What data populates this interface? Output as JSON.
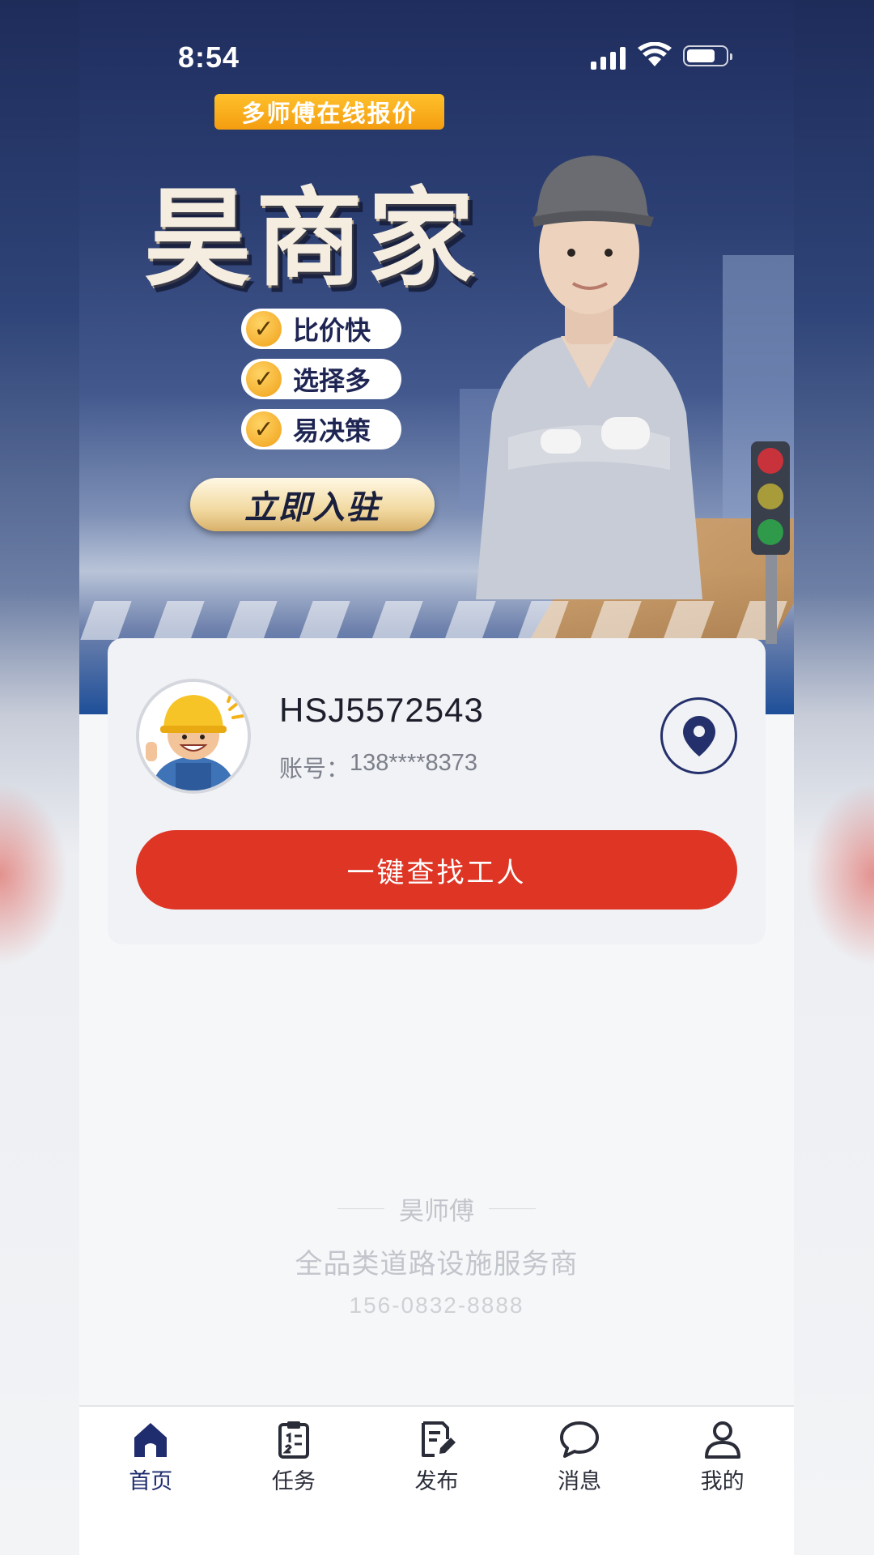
{
  "status_bar": {
    "time": "8:54"
  },
  "banner": {
    "tag": "多师傅在线报价",
    "brand": "昊商家",
    "features": [
      "比价快",
      "选择多",
      "易决策"
    ],
    "join_label": "立即入驻"
  },
  "profile": {
    "username": "HSJ5572543",
    "account_label": "账号：",
    "account_value": "138****8373",
    "find_worker_label": "一键查找工人"
  },
  "footer": {
    "name": "昊师傅",
    "slogan": "全品类道路设施服务商",
    "phone": "156-0832-8888"
  },
  "tabbar": {
    "items": [
      {
        "label": "首页",
        "icon": "home-icon",
        "active": true
      },
      {
        "label": "任务",
        "icon": "clipboard-icon",
        "active": false
      },
      {
        "label": "发布",
        "icon": "edit-document-icon",
        "active": false
      },
      {
        "label": "消息",
        "icon": "chat-bubble-icon",
        "active": false
      },
      {
        "label": "我的",
        "icon": "user-icon",
        "active": false
      }
    ]
  },
  "colors": {
    "primary": "#1f2c6e",
    "accent_red": "#de3524",
    "tag_orange": "#f49d10"
  }
}
